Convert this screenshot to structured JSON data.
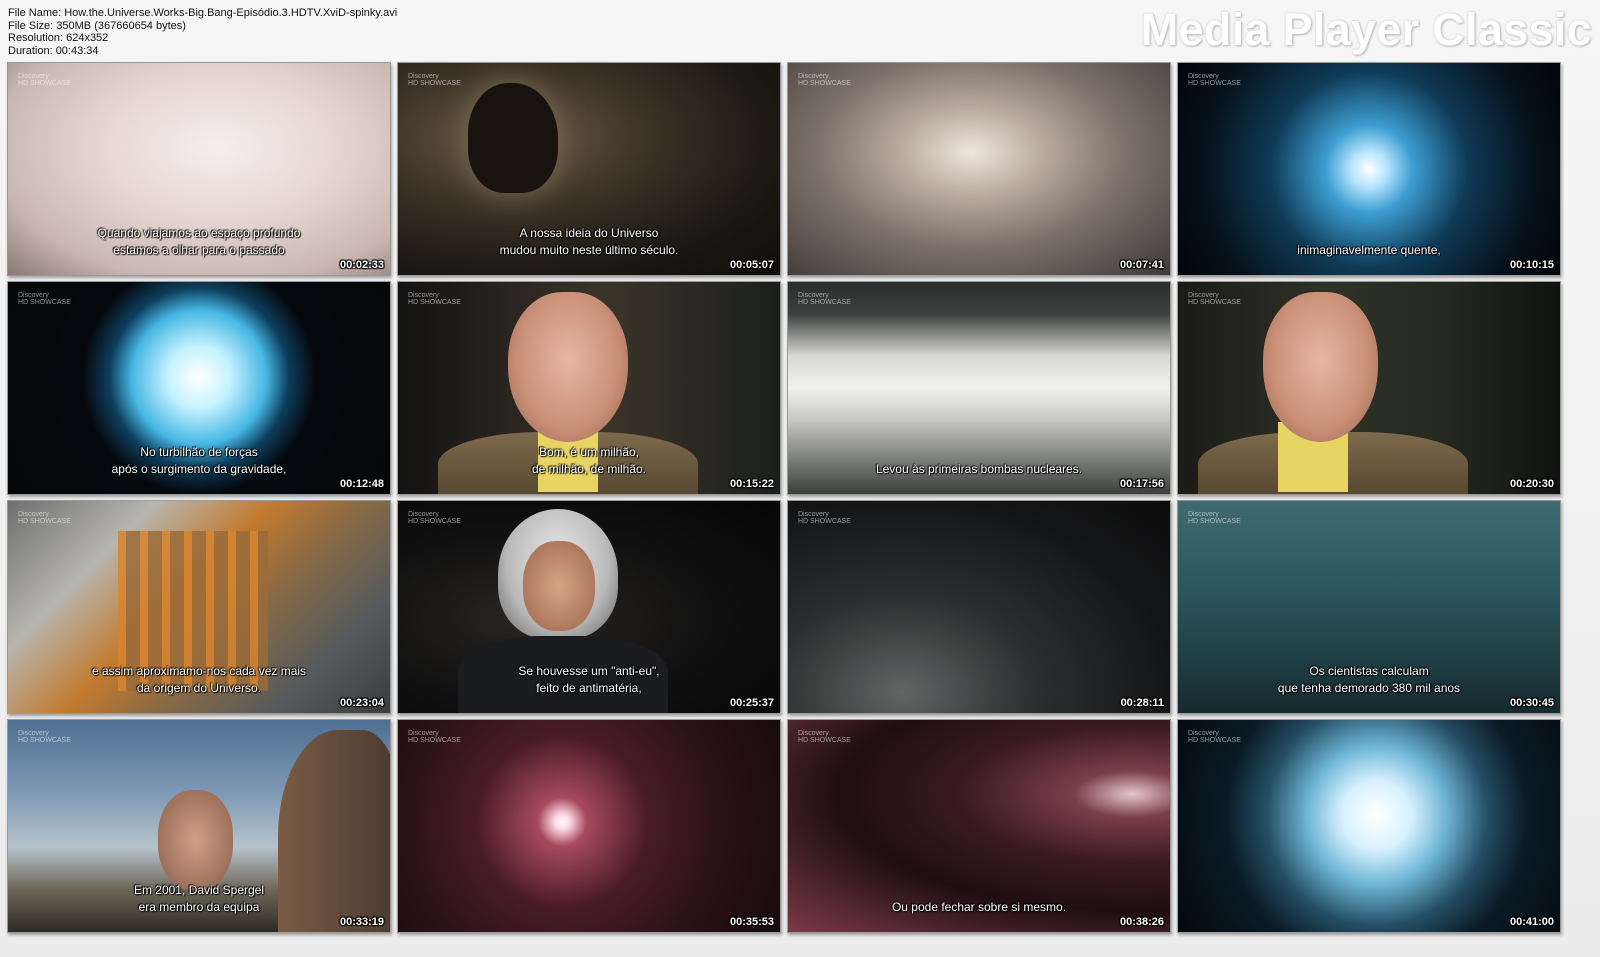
{
  "header": {
    "file_name": "File Name: How.the.Universe.Works-Big.Bang-Episódio.3.HDTV.XviD-spinky.avi",
    "file_size": "File Size: 350MB (367660654 bytes)",
    "resolution": "Resolution: 624x352",
    "duration": "Duration: 00:43:34",
    "brand": "Media Player Classic"
  },
  "thumbnails": [
    {
      "time": "00:02:33",
      "line1": "Quando viajamos ao espaço profundo",
      "line2": "estamos a olhar para o passado",
      "logo1": "Discovery",
      "logo2": "HD SHOWCASE"
    },
    {
      "time": "00:05:07",
      "line1": "A nossa ideia do Universo",
      "line2": "mudou muito neste último século.",
      "logo1": "Discovery",
      "logo2": "HD SHOWCASE"
    },
    {
      "time": "00:07:41",
      "line1": "",
      "line2": "",
      "logo1": "Discovery",
      "logo2": "HD SHOWCASE"
    },
    {
      "time": "00:10:15",
      "line1": "",
      "line2": "inimaginavelmente quente,",
      "logo1": "Discovery",
      "logo2": "HD SHOWCASE"
    },
    {
      "time": "00:12:48",
      "line1": "No turbilhão de forças",
      "line2": "após o surgimento da gravidade,",
      "logo1": "Discovery",
      "logo2": "HD SHOWCASE"
    },
    {
      "time": "00:15:22",
      "line1": "Bom, é um milhão,",
      "line2": "de milhão, de milhão.",
      "logo1": "Discovery",
      "logo2": "HD SHOWCASE"
    },
    {
      "time": "00:17:56",
      "line1": "",
      "line2": "Levou às primeiras bombas nucleares.",
      "logo1": "Discovery",
      "logo2": "HD SHOWCASE"
    },
    {
      "time": "00:20:30",
      "line1": "",
      "line2": "",
      "logo1": "Discovery",
      "logo2": "HD SHOWCASE"
    },
    {
      "time": "00:23:04",
      "line1": "e assim aproximamo-nos cada vez mais",
      "line2": "da origem do Universo.",
      "logo1": "Discovery",
      "logo2": "HD SHOWCASE"
    },
    {
      "time": "00:25:37",
      "line1": "Se houvesse um \"anti-eu\",",
      "line2": "feito de antimatéria,",
      "logo1": "Discovery",
      "logo2": "HD SHOWCASE"
    },
    {
      "time": "00:28:11",
      "line1": "",
      "line2": "",
      "logo1": "Discovery",
      "logo2": "HD SHOWCASE"
    },
    {
      "time": "00:30:45",
      "line1": "Os cientistas calculam",
      "line2": "que tenha demorado 380 mil anos",
      "logo1": "Discovery",
      "logo2": "HD SHOWCASE"
    },
    {
      "time": "00:33:19",
      "line1": "Em 2001, David Spergel",
      "line2": "era membro da equipa",
      "logo1": "Discovery",
      "logo2": "HD SHOWCASE"
    },
    {
      "time": "00:35:53",
      "line1": "",
      "line2": "",
      "logo1": "Discovery",
      "logo2": "HD SHOWCASE"
    },
    {
      "time": "00:38:26",
      "line1": "",
      "line2": "Ou pode fechar sobre si mesmo.",
      "logo1": "Discovery",
      "logo2": "HD SHOWCASE"
    },
    {
      "time": "00:41:00",
      "line1": "",
      "line2": "",
      "logo1": "Discovery",
      "logo2": "HD SHOWCASE"
    }
  ]
}
